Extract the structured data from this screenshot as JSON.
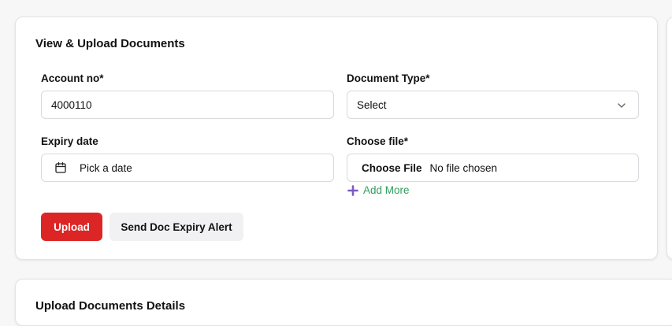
{
  "upload_card": {
    "title": "View & Upload Documents",
    "account_no": {
      "label": "Account no*",
      "value": "4000110"
    },
    "document_type": {
      "label": "Document Type*",
      "selected": "Select"
    },
    "expiry_date": {
      "label": "Expiry date",
      "placeholder": "Pick a date"
    },
    "choose_file": {
      "label": "Choose file*",
      "button_label": "Choose File",
      "status": "No file chosen"
    },
    "add_more_label": "Add More",
    "upload_button": "Upload",
    "alert_button": "Send Doc Expiry Alert"
  },
  "details_card": {
    "title": "Upload Documents Details"
  },
  "colors": {
    "primary_red": "#dc2626",
    "add_more_green": "#2f9e5e",
    "plus_icon_purple": "#7c5cc4"
  }
}
